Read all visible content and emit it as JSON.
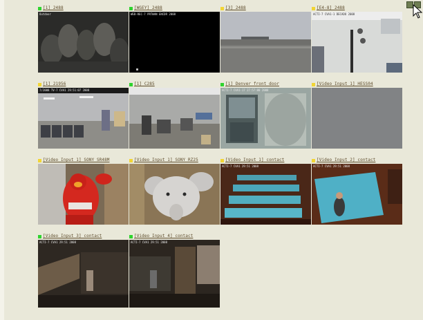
{
  "cameras": [
    {
      "label": "[1] 2488",
      "status_color": "#2fd32f",
      "osd": "Outdoor"
    },
    {
      "label": "[WGEY] 2488",
      "status_color": "#2fd32f",
      "osd": "WEB-REC-7 PRTWAN ENCDR 2008"
    },
    {
      "label": "[3] 2488",
      "status_color": "#f2d534",
      "osd": ""
    },
    {
      "label": "[E4-8] 2488",
      "status_color": "#f2d534",
      "osd": "ACTI-7 CVA1-1 DECADO 2008"
    },
    {
      "label": "[1] 21956",
      "status_color": "#f2d534",
      "osd": "7/2008 TV-7 CVA1 29:51:07 2008"
    },
    {
      "label": "[1] C285",
      "status_color": "#2fd32f",
      "osd": ""
    },
    {
      "label": "[1] Denver front door",
      "status_color": "#2fd32f",
      "osd": "ACTI-7 CVA1-17 27:57:00 2008"
    },
    {
      "label": "[Video Input 1] HESS04",
      "status_color": "#f2d534",
      "osd": ""
    },
    {
      "label": "[Video Input 1] SONY SR48M",
      "status_color": "#f2d534",
      "osd": ""
    },
    {
      "label": "[Video Input 1] SONY RZ25",
      "status_color": "#f2d534",
      "osd": ""
    },
    {
      "label": "[Video Input 1] contact",
      "status_color": "#f2d534",
      "osd": "ACTI-7 CVA1 29:51 2008"
    },
    {
      "label": "[Video Input 2] contact",
      "status_color": "#f2d534",
      "osd": "ACTI-7 CVA1 29:51 2008"
    },
    {
      "label": "[Video Input 3] contact",
      "status_color": "#2fd32f",
      "osd": "ACTI-7 CVA1 29:51 2008"
    },
    {
      "label": "[Video Input 4] contact",
      "status_color": "#2fd32f",
      "osd": "ACTI-7 CVA1 29:51 2008"
    }
  ],
  "corner_icon": "grid-view-icon",
  "cursor_icon": "mouse-pointer-icon",
  "colors": {
    "page_bg": "#e9e8d9",
    "label_text": "#5c4a2a",
    "status_ok": "#2fd32f",
    "status_warn": "#f2d534"
  }
}
